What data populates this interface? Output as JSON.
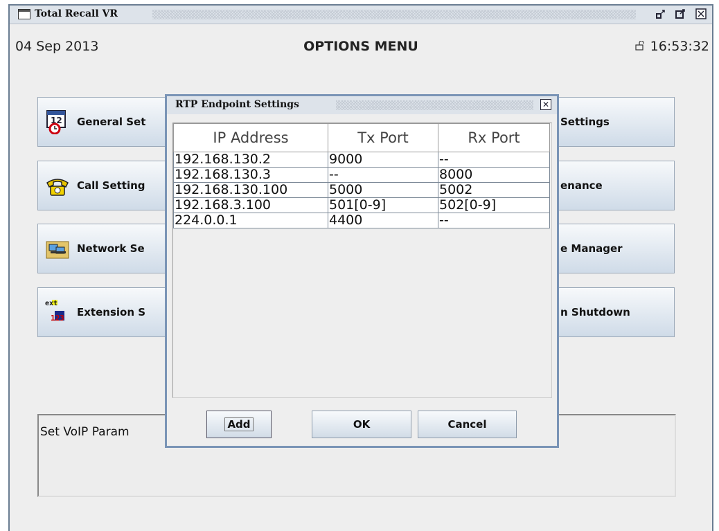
{
  "window": {
    "title": "Total Recall VR"
  },
  "header": {
    "date": "04 Sep 2013",
    "title": "OPTIONS MENU",
    "time": "16:53:32",
    "lock_icon": "lock-icon"
  },
  "menu": {
    "left": [
      {
        "label": "General Set",
        "icon": "calendar-clock-icon"
      },
      {
        "label": "Call Setting",
        "icon": "telephone-icon"
      },
      {
        "label": "Network Se",
        "icon": "network-computer-icon"
      },
      {
        "label": "Extension S",
        "icon": "extension-icon"
      }
    ],
    "right": [
      {
        "label": "Settings"
      },
      {
        "label": "enance"
      },
      {
        "label": "e Manager"
      },
      {
        "label": "n Shutdown"
      }
    ]
  },
  "description": "Set VoIP Param",
  "dialog": {
    "title": "RTP Endpoint Settings",
    "columns": [
      "IP Address",
      "Tx Port",
      "Rx Port"
    ],
    "rows": [
      [
        "192.168.130.2",
        "9000",
        "--"
      ],
      [
        "192.168.130.3",
        "--",
        "8000"
      ],
      [
        "192.168.130.100",
        "5000",
        "5002"
      ],
      [
        "192.168.3.100",
        "501[0-9]",
        "502[0-9]"
      ],
      [
        "224.0.0.1",
        "4400",
        "--"
      ]
    ],
    "buttons": {
      "add": "Add",
      "ok": "OK",
      "cancel": "Cancel"
    }
  },
  "ext_icon_text": {
    "top": "ext",
    "bottom": "123"
  }
}
